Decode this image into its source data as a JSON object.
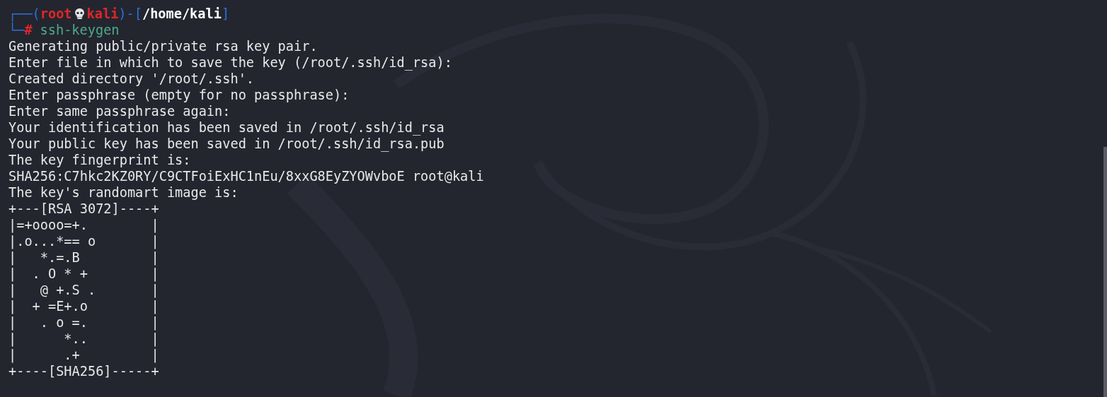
{
  "prompt": {
    "frame_top": "┌──(",
    "user": "root",
    "host": "kali",
    "separator": ")-[",
    "path": "/home/kali",
    "close": "]",
    "frame_bottom": "└─",
    "symbol": "#",
    "command": "ssh-keygen"
  },
  "output": [
    "Generating public/private rsa key pair.",
    "Enter file in which to save the key (/root/.ssh/id_rsa):",
    "Created directory '/root/.ssh'.",
    "Enter passphrase (empty for no passphrase):",
    "Enter same passphrase again:",
    "Your identification has been saved in /root/.ssh/id_rsa",
    "Your public key has been saved in /root/.ssh/id_rsa.pub",
    "The key fingerprint is:",
    "SHA256:C7hkc2KZ0RY/C9CTFoiExHC1nEu/8xxG8EyZYOWvboE root@kali",
    "The key's randomart image is:"
  ],
  "randomart": [
    "+---[RSA 3072]----+",
    "|=+oooo=+.        |",
    "|.o...*== o       |",
    "|   *.=.B         |",
    "|  . O * +        |",
    "|   @ +.S .       |",
    "|  + =E+.o        |",
    "|   . o =.        |",
    "|      *..        |",
    "|      .+         |",
    "+----[SHA256]-----+"
  ]
}
